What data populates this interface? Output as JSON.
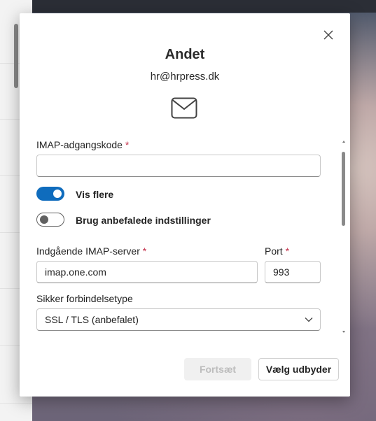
{
  "dialog": {
    "title": "Andet",
    "email": "hr@hrpress.dk",
    "close_icon": "close-icon",
    "mail_icon": "mail-icon"
  },
  "form": {
    "password": {
      "label": "IMAP-adgangskode",
      "required_marker": "*",
      "value": ""
    },
    "show_more": {
      "label": "Vis flere",
      "checked": true
    },
    "recommended": {
      "label": "Brug anbefalede indstillinger",
      "checked": false
    },
    "incoming_server": {
      "label": "Indgående IMAP-server",
      "required_marker": "*",
      "value": "imap.one.com"
    },
    "port": {
      "label": "Port",
      "required_marker": "*",
      "value": "993"
    },
    "connection_type": {
      "label": "Sikker forbindelsetype",
      "selected": "SSL / TLS (anbefalet)",
      "chevron_icon": "chevron-down-icon"
    }
  },
  "buttons": {
    "continue_label": "Fortsæt",
    "choose_provider_label": "Vælg udbyder"
  },
  "colors": {
    "accent": "#0f6cbd",
    "required": "#c4314b"
  }
}
